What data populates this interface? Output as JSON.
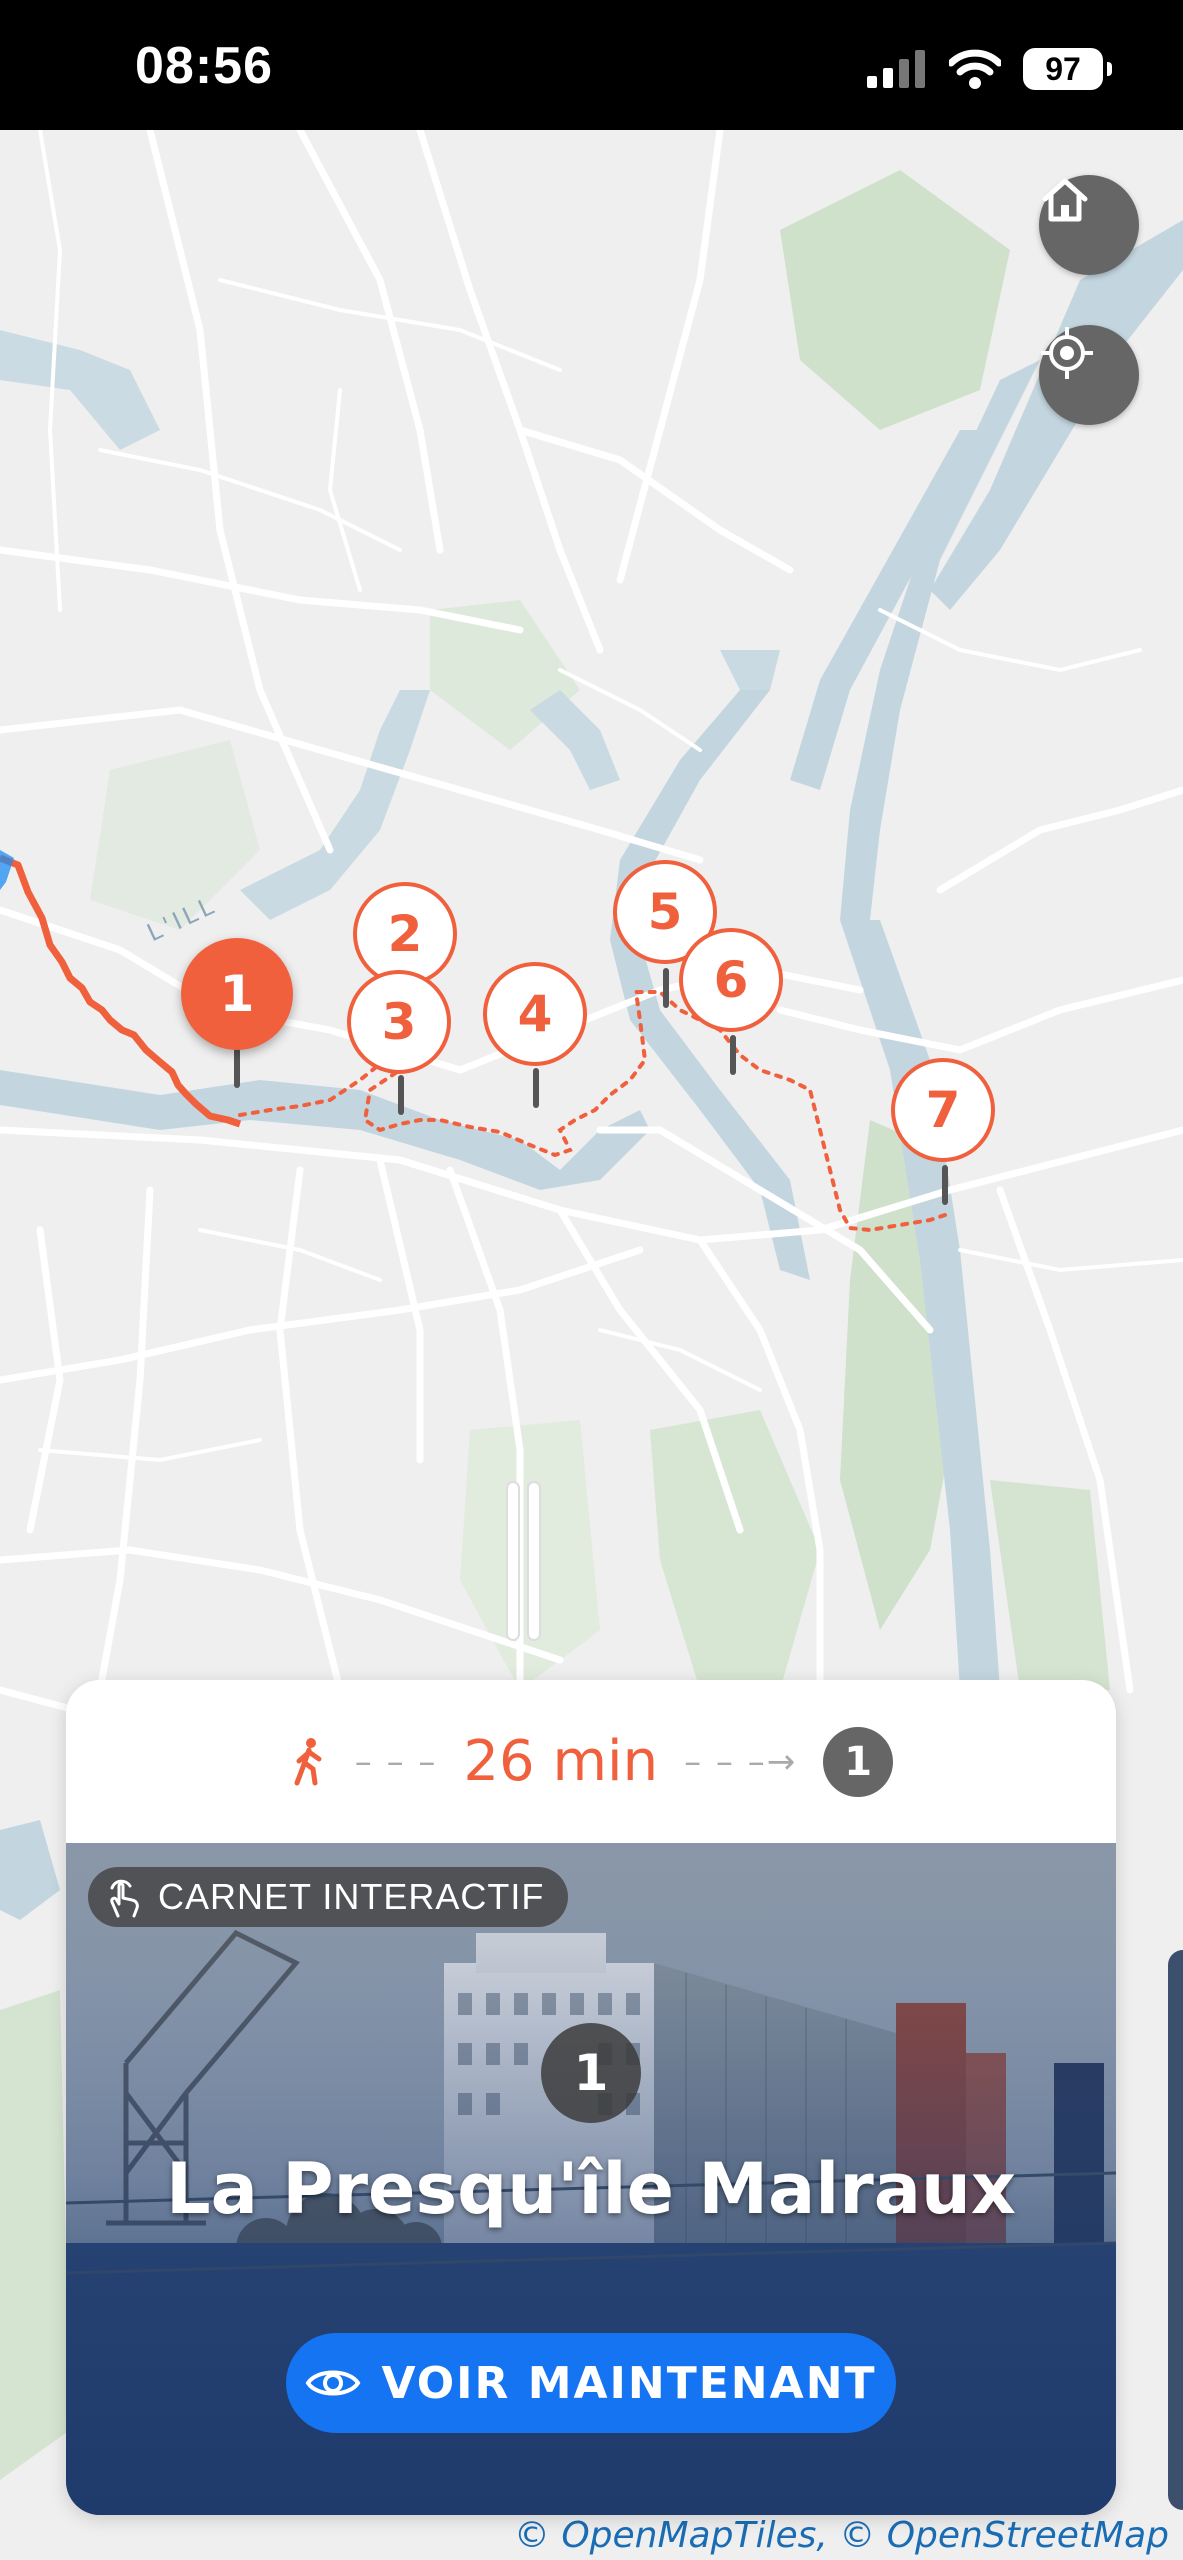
{
  "status_bar": {
    "time": "08:56",
    "battery": "97"
  },
  "map": {
    "home_button_icon": "home-icon",
    "locate_button_icon": "locate-icon",
    "river_label": "L'ILL",
    "pins": [
      {
        "label": "1",
        "active": true
      },
      {
        "label": "2"
      },
      {
        "label": "3"
      },
      {
        "label": "4"
      },
      {
        "label": "5"
      },
      {
        "label": "6"
      },
      {
        "label": "7"
      }
    ],
    "attribution": "© OpenMapTiles, © OpenStreetMap"
  },
  "card": {
    "walk_icon": "walking-person-icon",
    "dashes_left": "– – –",
    "dashes_right": "– – –→",
    "duration": "26 min",
    "destination_badge": "1",
    "chip_icon": "touch-gesture-icon",
    "chip_label": "CARNET INTERACTIF",
    "stop_number": "1",
    "stop_title": "La Presqu'île Malraux",
    "cta_icon": "eye-icon",
    "cta_label": "VOIR MAINTENANT"
  },
  "colors": {
    "accent": "#f0603d",
    "cta": "#1574f1",
    "water": "#c3d6e0",
    "park": "#cfe1cb"
  }
}
